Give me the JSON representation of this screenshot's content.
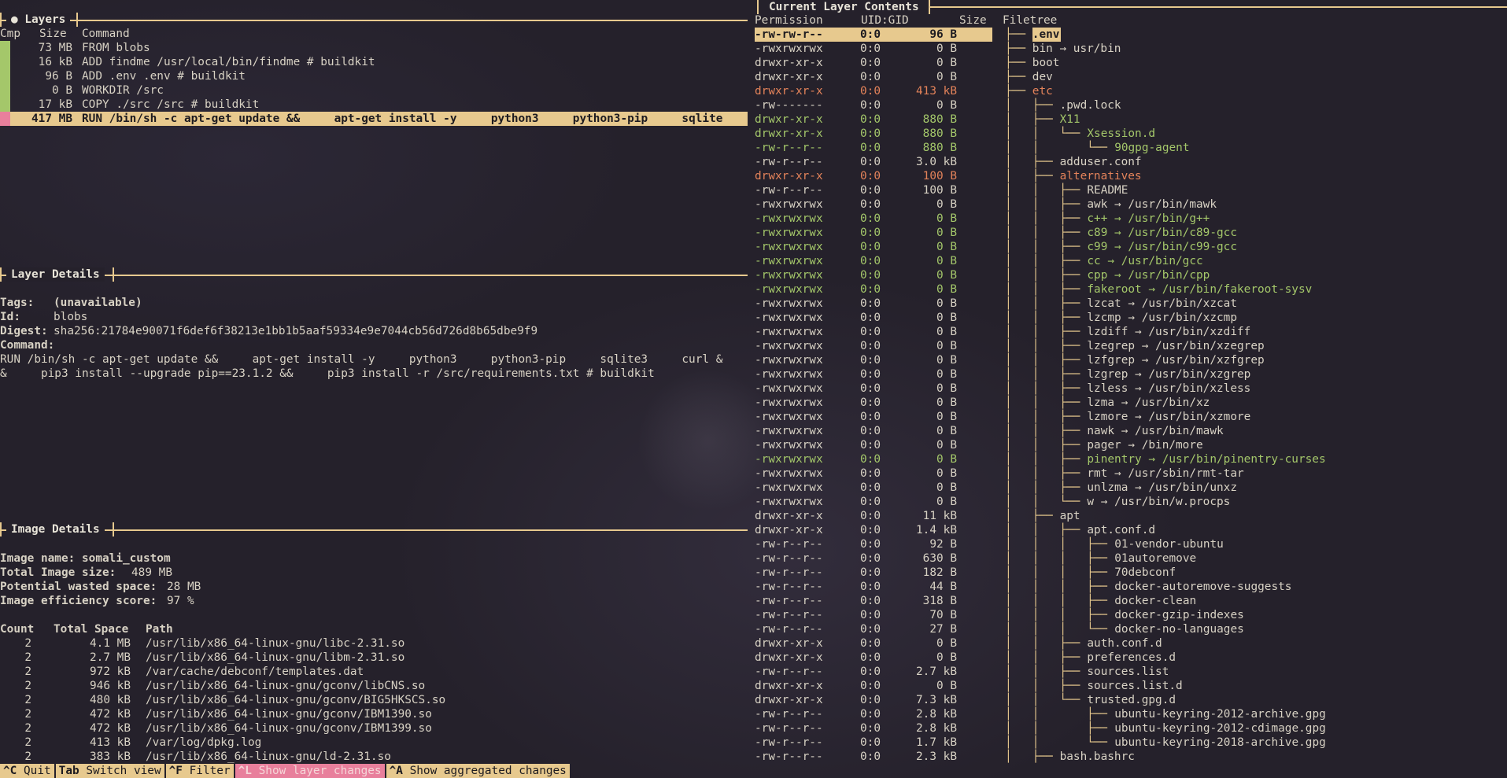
{
  "layers_pane": {
    "title": "● Layers",
    "headers": {
      "cmp": "Cmp",
      "size": "Size",
      "command": "Command"
    },
    "rows": [
      {
        "size": "73 MB",
        "command": "FROM blobs",
        "bar_color": "#a4c76a"
      },
      {
        "size": "16 kB",
        "command": "ADD findme /usr/local/bin/findme # buildkit",
        "bar_color": "#a4c76a"
      },
      {
        "size": "96 B",
        "command": "ADD .env .env # buildkit",
        "bar_color": "#a4c76a"
      },
      {
        "size": "0 B",
        "command": "WORKDIR /src",
        "bar_color": "#a4c76a"
      },
      {
        "size": "17 kB",
        "command": "COPY ./src /src # buildkit",
        "bar_color": "#a4c76a"
      },
      {
        "size": "417 MB",
        "command": "RUN /bin/sh -c apt-get update &&     apt-get install -y     python3     python3-pip     sqlite",
        "bar_color": "#e87f9c",
        "selected": true
      }
    ]
  },
  "layer_details": {
    "title": "Layer Details",
    "tags_label": "Tags:",
    "tags_value": "(unavailable)",
    "id_label": "Id:",
    "id_value": "blobs",
    "digest_label": "Digest:",
    "digest_value": "sha256:21784e90071f6def6f38213e1bb1b5aaf59334e9e7044cb56d726d8b65dbe9f9",
    "command_label": "Command:",
    "command_line1": "RUN /bin/sh -c apt-get update &&     apt-get install -y     python3     python3-pip     sqlite3     curl &",
    "command_line2": "&     pip3 install --upgrade pip==23.1.2 &&     pip3 install -r /src/requirements.txt # buildkit"
  },
  "image_details": {
    "title": "Image Details",
    "name_label": "Image name:",
    "name_value": "somali_custom",
    "size_label": "Total Image size:",
    "size_value": "489 MB",
    "wasted_label": "Potential wasted space:",
    "wasted_value": "28 MB",
    "efficiency_label": "Image efficiency score:",
    "efficiency_value": "97 %",
    "headers": {
      "count": "Count",
      "total": "Total Space",
      "path": "Path"
    },
    "rows": [
      {
        "count": "2",
        "total": "4.1 MB",
        "path": "/usr/lib/x86_64-linux-gnu/libc-2.31.so"
      },
      {
        "count": "2",
        "total": "2.7 MB",
        "path": "/usr/lib/x86_64-linux-gnu/libm-2.31.so"
      },
      {
        "count": "2",
        "total": "972 kB",
        "path": "/var/cache/debconf/templates.dat"
      },
      {
        "count": "2",
        "total": "946 kB",
        "path": "/usr/lib/x86_64-linux-gnu/gconv/libCNS.so"
      },
      {
        "count": "2",
        "total": "480 kB",
        "path": "/usr/lib/x86_64-linux-gnu/gconv/BIG5HKSCS.so"
      },
      {
        "count": "2",
        "total": "472 kB",
        "path": "/usr/lib/x86_64-linux-gnu/gconv/IBM1390.so"
      },
      {
        "count": "2",
        "total": "472 kB",
        "path": "/usr/lib/x86_64-linux-gnu/gconv/IBM1399.so"
      },
      {
        "count": "2",
        "total": "413 kB",
        "path": "/var/log/dpkg.log"
      },
      {
        "count": "2",
        "total": "383 kB",
        "path": "/usr/lib/x86_64-linux-gnu/ld-2.31.so"
      }
    ]
  },
  "contents_pane": {
    "title": "Current Layer Contents",
    "headers": {
      "perm": "Permission",
      "uid": "UID:GID",
      "size": "Size",
      "tree": "Filetree"
    },
    "rows": [
      {
        "perm": "-rw-rw-r--",
        "uid": "0:0",
        "size": "96 B",
        "prefix": "├── ",
        "name": ".env",
        "color": "sel"
      },
      {
        "perm": "-rwxrwxrwx",
        "uid": "0:0",
        "size": "0 B",
        "prefix": "├── ",
        "name": "bin → usr/bin",
        "color": "white"
      },
      {
        "perm": "drwxr-xr-x",
        "uid": "0:0",
        "size": "0 B",
        "prefix": "├── ",
        "name": "boot",
        "color": "white"
      },
      {
        "perm": "drwxr-xr-x",
        "uid": "0:0",
        "size": "0 B",
        "prefix": "├── ",
        "name": "dev",
        "color": "white"
      },
      {
        "perm": "drwxr-xr-x",
        "uid": "0:0",
        "size": "413 kB",
        "prefix": "├── ",
        "name": "etc",
        "color": "orange"
      },
      {
        "perm": "-rw-------",
        "uid": "0:0",
        "size": "0 B",
        "prefix": "│   ├── ",
        "name": ".pwd.lock",
        "color": "white"
      },
      {
        "perm": "drwxr-xr-x",
        "uid": "0:0",
        "size": "880 B",
        "prefix": "│   ├── ",
        "name": "X11",
        "color": "green"
      },
      {
        "perm": "drwxr-xr-x",
        "uid": "0:0",
        "size": "880 B",
        "prefix": "│   │   └── ",
        "name": "Xsession.d",
        "color": "green"
      },
      {
        "perm": "-rw-r--r--",
        "uid": "0:0",
        "size": "880 B",
        "prefix": "│   │       └── ",
        "name": "90gpg-agent",
        "color": "green"
      },
      {
        "perm": "-rw-r--r--",
        "uid": "0:0",
        "size": "3.0 kB",
        "prefix": "│   ├── ",
        "name": "adduser.conf",
        "color": "white"
      },
      {
        "perm": "drwxr-xr-x",
        "uid": "0:0",
        "size": "100 B",
        "prefix": "│   ├── ",
        "name": "alternatives",
        "color": "orange"
      },
      {
        "perm": "-rw-r--r--",
        "uid": "0:0",
        "size": "100 B",
        "prefix": "│   │   ├── ",
        "name": "README",
        "color": "white"
      },
      {
        "perm": "-rwxrwxrwx",
        "uid": "0:0",
        "size": "0 B",
        "prefix": "│   │   ├── ",
        "name": "awk → /usr/bin/mawk",
        "color": "white"
      },
      {
        "perm": "-rwxrwxrwx",
        "uid": "0:0",
        "size": "0 B",
        "prefix": "│   │   ├── ",
        "name": "c++ → /usr/bin/g++",
        "color": "green"
      },
      {
        "perm": "-rwxrwxrwx",
        "uid": "0:0",
        "size": "0 B",
        "prefix": "│   │   ├── ",
        "name": "c89 → /usr/bin/c89-gcc",
        "color": "green"
      },
      {
        "perm": "-rwxrwxrwx",
        "uid": "0:0",
        "size": "0 B",
        "prefix": "│   │   ├── ",
        "name": "c99 → /usr/bin/c99-gcc",
        "color": "green"
      },
      {
        "perm": "-rwxrwxrwx",
        "uid": "0:0",
        "size": "0 B",
        "prefix": "│   │   ├── ",
        "name": "cc → /usr/bin/gcc",
        "color": "green"
      },
      {
        "perm": "-rwxrwxrwx",
        "uid": "0:0",
        "size": "0 B",
        "prefix": "│   │   ├── ",
        "name": "cpp → /usr/bin/cpp",
        "color": "green"
      },
      {
        "perm": "-rwxrwxrwx",
        "uid": "0:0",
        "size": "0 B",
        "prefix": "│   │   ├── ",
        "name": "fakeroot → /usr/bin/fakeroot-sysv",
        "color": "green"
      },
      {
        "perm": "-rwxrwxrwx",
        "uid": "0:0",
        "size": "0 B",
        "prefix": "│   │   ├── ",
        "name": "lzcat → /usr/bin/xzcat",
        "color": "white"
      },
      {
        "perm": "-rwxrwxrwx",
        "uid": "0:0",
        "size": "0 B",
        "prefix": "│   │   ├── ",
        "name": "lzcmp → /usr/bin/xzcmp",
        "color": "white"
      },
      {
        "perm": "-rwxrwxrwx",
        "uid": "0:0",
        "size": "0 B",
        "prefix": "│   │   ├── ",
        "name": "lzdiff → /usr/bin/xzdiff",
        "color": "white"
      },
      {
        "perm": "-rwxrwxrwx",
        "uid": "0:0",
        "size": "0 B",
        "prefix": "│   │   ├── ",
        "name": "lzegrep → /usr/bin/xzegrep",
        "color": "white"
      },
      {
        "perm": "-rwxrwxrwx",
        "uid": "0:0",
        "size": "0 B",
        "prefix": "│   │   ├── ",
        "name": "lzfgrep → /usr/bin/xzfgrep",
        "color": "white"
      },
      {
        "perm": "-rwxrwxrwx",
        "uid": "0:0",
        "size": "0 B",
        "prefix": "│   │   ├── ",
        "name": "lzgrep → /usr/bin/xzgrep",
        "color": "white"
      },
      {
        "perm": "-rwxrwxrwx",
        "uid": "0:0",
        "size": "0 B",
        "prefix": "│   │   ├── ",
        "name": "lzless → /usr/bin/xzless",
        "color": "white"
      },
      {
        "perm": "-rwxrwxrwx",
        "uid": "0:0",
        "size": "0 B",
        "prefix": "│   │   ├── ",
        "name": "lzma → /usr/bin/xz",
        "color": "white"
      },
      {
        "perm": "-rwxrwxrwx",
        "uid": "0:0",
        "size": "0 B",
        "prefix": "│   │   ├── ",
        "name": "lzmore → /usr/bin/xzmore",
        "color": "white"
      },
      {
        "perm": "-rwxrwxrwx",
        "uid": "0:0",
        "size": "0 B",
        "prefix": "│   │   ├── ",
        "name": "nawk → /usr/bin/mawk",
        "color": "white"
      },
      {
        "perm": "-rwxrwxrwx",
        "uid": "0:0",
        "size": "0 B",
        "prefix": "│   │   ├── ",
        "name": "pager → /bin/more",
        "color": "white"
      },
      {
        "perm": "-rwxrwxrwx",
        "uid": "0:0",
        "size": "0 B",
        "prefix": "│   │   ├── ",
        "name": "pinentry → /usr/bin/pinentry-curses",
        "color": "green"
      },
      {
        "perm": "-rwxrwxrwx",
        "uid": "0:0",
        "size": "0 B",
        "prefix": "│   │   ├── ",
        "name": "rmt → /usr/sbin/rmt-tar",
        "color": "white"
      },
      {
        "perm": "-rwxrwxrwx",
        "uid": "0:0",
        "size": "0 B",
        "prefix": "│   │   ├── ",
        "name": "unlzma → /usr/bin/unxz",
        "color": "white"
      },
      {
        "perm": "-rwxrwxrwx",
        "uid": "0:0",
        "size": "0 B",
        "prefix": "│   │   └── ",
        "name": "w → /usr/bin/w.procps",
        "color": "white"
      },
      {
        "perm": "drwxr-xr-x",
        "uid": "0:0",
        "size": "11 kB",
        "prefix": "│   ├── ",
        "name": "apt",
        "color": "white"
      },
      {
        "perm": "drwxr-xr-x",
        "uid": "0:0",
        "size": "1.4 kB",
        "prefix": "│   │   ├── ",
        "name": "apt.conf.d",
        "color": "white"
      },
      {
        "perm": "-rw-r--r--",
        "uid": "0:0",
        "size": "92 B",
        "prefix": "│   │   │   ├── ",
        "name": "01-vendor-ubuntu",
        "color": "white"
      },
      {
        "perm": "-rw-r--r--",
        "uid": "0:0",
        "size": "630 B",
        "prefix": "│   │   │   ├── ",
        "name": "01autoremove",
        "color": "white"
      },
      {
        "perm": "-rw-r--r--",
        "uid": "0:0",
        "size": "182 B",
        "prefix": "│   │   │   ├── ",
        "name": "70debconf",
        "color": "white"
      },
      {
        "perm": "-rw-r--r--",
        "uid": "0:0",
        "size": "44 B",
        "prefix": "│   │   │   ├── ",
        "name": "docker-autoremove-suggests",
        "color": "white"
      },
      {
        "perm": "-rw-r--r--",
        "uid": "0:0",
        "size": "318 B",
        "prefix": "│   │   │   ├── ",
        "name": "docker-clean",
        "color": "white"
      },
      {
        "perm": "-rw-r--r--",
        "uid": "0:0",
        "size": "70 B",
        "prefix": "│   │   │   ├── ",
        "name": "docker-gzip-indexes",
        "color": "white"
      },
      {
        "perm": "-rw-r--r--",
        "uid": "0:0",
        "size": "27 B",
        "prefix": "│   │   │   └── ",
        "name": "docker-no-languages",
        "color": "white"
      },
      {
        "perm": "drwxr-xr-x",
        "uid": "0:0",
        "size": "0 B",
        "prefix": "│   │   ├── ",
        "name": "auth.conf.d",
        "color": "white"
      },
      {
        "perm": "drwxr-xr-x",
        "uid": "0:0",
        "size": "0 B",
        "prefix": "│   │   ├── ",
        "name": "preferences.d",
        "color": "white"
      },
      {
        "perm": "-rw-r--r--",
        "uid": "0:0",
        "size": "2.7 kB",
        "prefix": "│   │   ├── ",
        "name": "sources.list",
        "color": "white"
      },
      {
        "perm": "drwxr-xr-x",
        "uid": "0:0",
        "size": "0 B",
        "prefix": "│   │   ├── ",
        "name": "sources.list.d",
        "color": "white"
      },
      {
        "perm": "drwxr-xr-x",
        "uid": "0:0",
        "size": "7.3 kB",
        "prefix": "│   │   └── ",
        "name": "trusted.gpg.d",
        "color": "white"
      },
      {
        "perm": "-rw-r--r--",
        "uid": "0:0",
        "size": "2.8 kB",
        "prefix": "│   │       ├── ",
        "name": "ubuntu-keyring-2012-archive.gpg",
        "color": "white"
      },
      {
        "perm": "-rw-r--r--",
        "uid": "0:0",
        "size": "2.8 kB",
        "prefix": "│   │       ├── ",
        "name": "ubuntu-keyring-2012-cdimage.gpg",
        "color": "white"
      },
      {
        "perm": "-rw-r--r--",
        "uid": "0:0",
        "size": "1.7 kB",
        "prefix": "│   │       └── ",
        "name": "ubuntu-keyring-2018-archive.gpg",
        "color": "white"
      },
      {
        "perm": "-rw-r--r--",
        "uid": "0:0",
        "size": "2.3 kB",
        "prefix": "│   ├── ",
        "name": "bash.bashrc",
        "color": "white"
      }
    ]
  },
  "footer": {
    "items": [
      {
        "key": "^C",
        "label": "Quit",
        "active": false
      },
      {
        "key": "Tab",
        "label": "Switch view",
        "active": false
      },
      {
        "key": "^F",
        "label": "Filter",
        "active": false
      },
      {
        "key": "^L",
        "label": "Show layer changes",
        "active": true
      },
      {
        "key": "^A",
        "label": "Show aggregated changes",
        "active": false
      }
    ]
  }
}
